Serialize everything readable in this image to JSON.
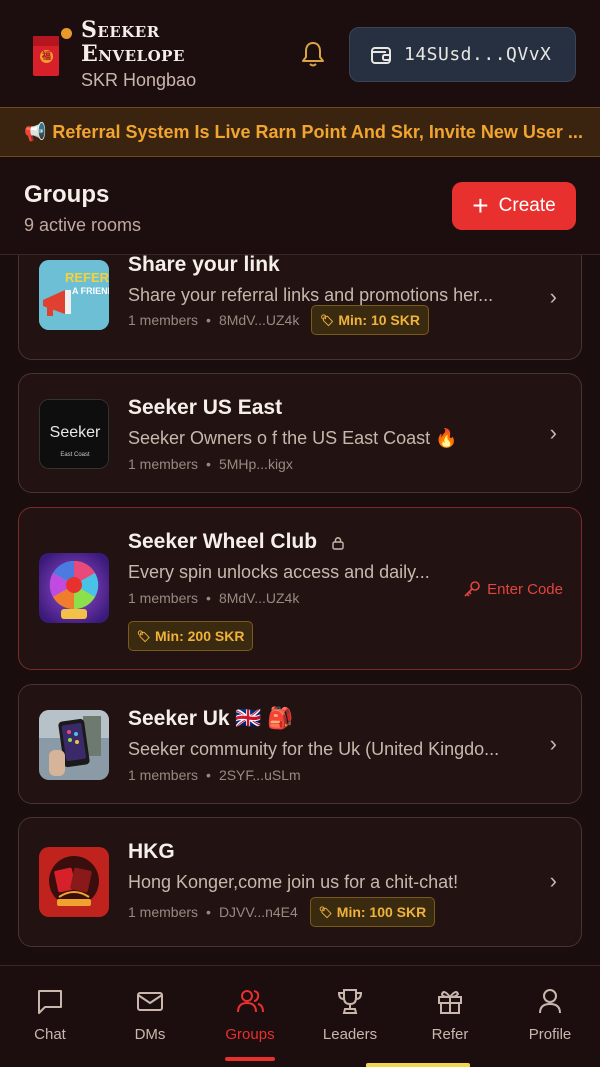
{
  "header": {
    "brand_title_line1": "Seeker",
    "brand_title_line2": "Envelope",
    "brand_subtitle": "SKR Hongbao",
    "logo_glyph": "福",
    "wallet_address": "14SUsd...QVvX"
  },
  "banner": {
    "icon": "📢",
    "text": "Referral System Is Live Rarn Point And Skr, Invite New User ..."
  },
  "groups": {
    "title": "Groups",
    "count_text": "9 active rooms",
    "create_label": "Create"
  },
  "cards": [
    {
      "title": "Share your link",
      "description": "Share your referral links and promotions her...",
      "members": "1 members",
      "address": "8MdV...UZ4k",
      "min": "Min: 10 SKR",
      "thumb_text": "REFER A FRIEND"
    },
    {
      "title": "Seeker US East",
      "description": "Seeker Owners o f the US East Coast 🔥",
      "members": "1 members",
      "address": "5MHp...kigx",
      "thumb_text": "Seeker",
      "thumb_subtext": "East Coast"
    },
    {
      "title": "Seeker Wheel Club",
      "description": "Every spin unlocks access and daily...",
      "members": "1 members",
      "address": "8MdV...UZ4k",
      "min": "Min: 200 SKR",
      "action": "Enter Code"
    },
    {
      "title": "Seeker Uk 🇬🇧 🎒",
      "description": "Seeker community for the Uk (United Kingdo...",
      "members": "1 members",
      "address": "2SYF...uSLm"
    },
    {
      "title": "HKG",
      "description": "Hong Konger,come join us for a chit-chat!",
      "members": "1 members",
      "address": "DJVV...n4E4",
      "min": "Min: 100 SKR"
    }
  ],
  "nav": {
    "items": [
      "Chat",
      "DMs",
      "Groups",
      "Leaders",
      "Refer",
      "Profile"
    ],
    "active": "Groups"
  },
  "colors": {
    "accent": "#e8302f",
    "gold": "#f0a531",
    "background": "#1a0d0d"
  }
}
